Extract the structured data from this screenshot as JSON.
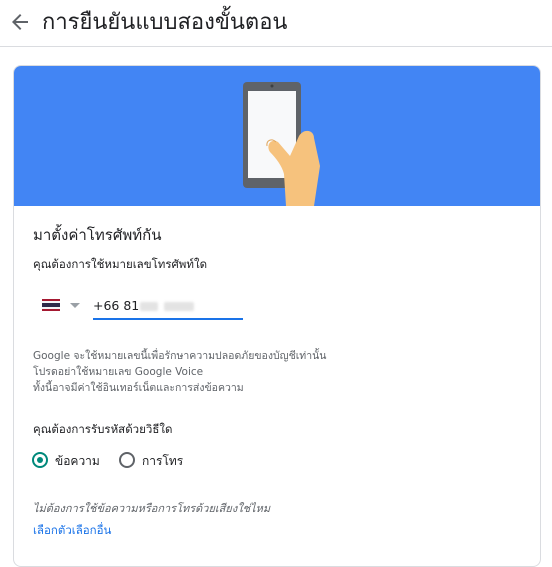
{
  "header": {
    "back_icon": "arrow-left-icon",
    "title": "การยืนยันแบบสองขั้นตอน"
  },
  "banner": {
    "color": "#4285f4",
    "illustration": "hand-holding-phone-icon"
  },
  "setup": {
    "title": "มาตั้งค่าโทรศัพท์กัน",
    "phone_question": "คุณต้องการใช้หมายเลขโทรศัพท์ใด",
    "country_flag": "thailand-flag-icon",
    "phone_value": "+66 81",
    "info_lines": [
      "Google จะใช้หมายเลขนี้เพื่อรักษาความปลอดภัยของบัญชีเท่านั้น",
      "โปรดอย่าใช้หมายเลข Google Voice",
      "ทั้งนี้อาจมีค่าใช้อินเทอร์เน็ตและการส่งข้อความ"
    ],
    "method_question": "คุณต้องการรับรหัสด้วยวิธีใด",
    "methods": [
      {
        "label": "ข้อความ",
        "selected": true
      },
      {
        "label": "การโทร",
        "selected": false
      }
    ],
    "alternative_question": "ไม่ต้องการใช้ข้อความหรือการโทรด้วยเสียงใช่ไหม",
    "alternative_link": "เลือกตัวเลือกอื่น",
    "accent_color": "#00897b",
    "link_color": "#1a73e8"
  }
}
